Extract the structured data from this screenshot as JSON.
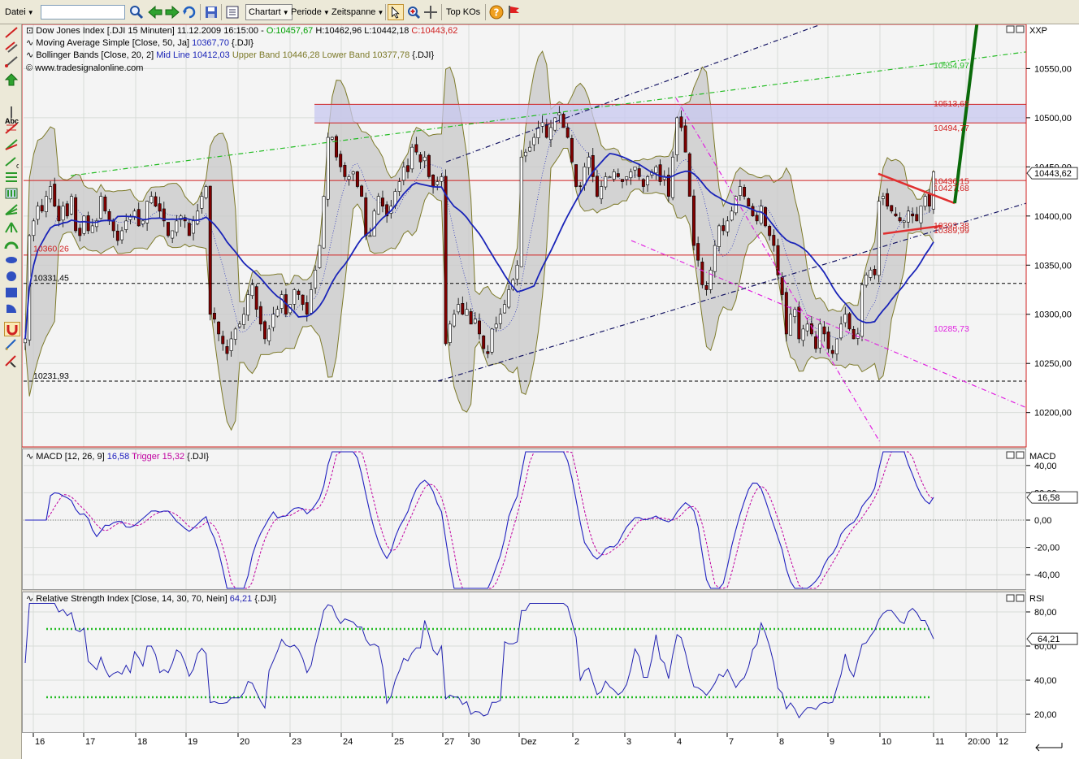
{
  "toolbar": {
    "file_menu": "Datei",
    "search_value": "",
    "chart_type": "Chartart",
    "period": "Periode",
    "timespan": "Zeitspanne",
    "top_kos": "Top KOs"
  },
  "main_panel": {
    "header_lines": [
      {
        "pre": "Dow Jones Index [.DJI  15 Minuten]  11.12.2009 16:15:00 - ",
        "o": "O:10457,67",
        "h": " H:10462,96",
        "l": " L:10442,18",
        "c": " C:10443,62"
      },
      {
        "pre": "Moving Average Simple [Close, 50, Ja] ",
        "v": "10367,70",
        "post": " {.DJI}"
      },
      {
        "pre": "Bollinger Bands [Close, 20, 2] ",
        "mid": "Mid Line 10412,03",
        "up": " Upper Band 10446,28",
        "lo": " Lower Band 10377,78",
        "post": " {.DJI}"
      },
      {
        "pre": "© www.tradesignalonline.com"
      }
    ],
    "axis_title": "XXP",
    "current_price": "10443,62",
    "y_ticks": [
      "10550,00",
      "10500,00",
      "10450,00",
      "10400,00",
      "10350,00",
      "10300,00",
      "10250,00",
      "10200,00"
    ],
    "levels_left": [
      "10360,26",
      "10331,45",
      "10231,93"
    ],
    "levels_right": {
      "l1": "10554,97",
      "l2": "10513,65",
      "l3": "10494,77",
      "l4": "10436,15",
      "l5": "10427,68",
      "l6": "10393,38",
      "l7": "10389,99",
      "l8": "10285,73"
    }
  },
  "macd_panel": {
    "header": {
      "pre": "MACD [12, 26, 9] ",
      "v": "16,58",
      "trig": " Trigger 15,32",
      "post": " {.DJI}"
    },
    "axis_title": "MACD",
    "current_value": "16,58",
    "y_ticks": [
      "40,00",
      "20,00",
      "0,00",
      "-20,00",
      "-40,00"
    ]
  },
  "rsi_panel": {
    "header": {
      "pre": "Relative Strength Index [Close, 14, 30, 70, Nein] ",
      "v": "64,21",
      "post": " {.DJI}"
    },
    "axis_title": "RSI",
    "current_value": "64,21",
    "y_ticks": [
      "80,00",
      "60,00",
      "40,00",
      "20,00"
    ]
  },
  "x_axis_labels": [
    "16",
    "17",
    "18",
    "19",
    "20",
    "23",
    "24",
    "25",
    "27",
    "30",
    "Dez",
    "2",
    "3",
    "4",
    "7",
    "8",
    "9",
    "10",
    "11",
    "20:00",
    "12"
  ],
  "colors": {
    "up": "#ffffff",
    "down": "#800000",
    "ma": "#1a24b8",
    "band": "#7d7a2a",
    "band_fill": "#c8c8c8",
    "macd": "#2020c0",
    "trigger": "#c000a0",
    "rsi": "#2020b0",
    "rsi_levels": "#22bb22",
    "hline": "#d02020",
    "zone": "#c8c8f0"
  },
  "chart_data": {
    "type": "candlestick",
    "title": "Dow Jones Index [.DJI  15 Minuten]",
    "xlabel": "",
    "ylabel": "",
    "ylim": [
      10165,
      10595
    ],
    "grid": true,
    "closes": [
      10275,
      10380,
      10395,
      10410,
      10405,
      10420,
      10430,
      10410,
      10395,
      10410,
      10400,
      10420,
      10385,
      10380,
      10400,
      10385,
      10390,
      10395,
      10420,
      10405,
      10395,
      10385,
      10375,
      10385,
      10395,
      10400,
      10405,
      10390,
      10395,
      10415,
      10420,
      10410,
      10405,
      10395,
      10380,
      10385,
      10395,
      10400,
      10395,
      10380,
      10395,
      10405,
      10420,
      10430,
      10300,
      10295,
      10280,
      10270,
      10260,
      10275,
      10285,
      10290,
      10300,
      10320,
      10330,
      10305,
      10290,
      10275,
      10285,
      10300,
      10305,
      10320,
      10300,
      10310,
      10325,
      10320,
      10310,
      10300,
      10325,
      10345,
      10370,
      10420,
      10480,
      10480,
      10460,
      10450,
      10440,
      10440,
      10445,
      10430,
      10420,
      10380,
      10380,
      10405,
      10420,
      10410,
      10400,
      10410,
      10425,
      10435,
      10450,
      10445,
      10470,
      10465,
      10455,
      10460,
      10440,
      10430,
      10435,
      10440,
      10270,
      10290,
      10300,
      10310,
      10300,
      10305,
      10290,
      10295,
      10280,
      10265,
      10260,
      10285,
      10290,
      10300,
      10310,
      10325,
      10335,
      10350,
      10460,
      10465,
      10470,
      10480,
      10490,
      10495,
      10480,
      10490,
      10500,
      10505,
      10490,
      10480,
      10455,
      10430,
      10430,
      10450,
      10460,
      10440,
      10420,
      10430,
      10440,
      10440,
      10445,
      10440,
      10435,
      10440,
      10445,
      10450,
      10440,
      10430,
      10440,
      10445,
      10450,
      10435,
      10440,
      10420,
      10460,
      10500,
      10490,
      10465,
      10420,
      10370,
      10355,
      10330,
      10325,
      10345,
      10370,
      10390,
      10385,
      10395,
      10405,
      10420,
      10430,
      10420,
      10410,
      10400,
      10395,
      10410,
      10390,
      10380,
      10370,
      10340,
      10320,
      10280,
      10300,
      10305,
      10275,
      10285,
      10290,
      10280,
      10265,
      10290,
      10280,
      10265,
      10260,
      10275,
      10290,
      10300,
      10285,
      10275,
      10280,
      10330,
      10340,
      10345,
      10340,
      10415,
      10420,
      10410,
      10405,
      10400,
      10395,
      10395,
      10405,
      10400,
      10395,
      10410,
      10420,
      10410,
      10445
    ],
    "sma50_last": 10367.7,
    "bollinger": {
      "mid": 10412.03,
      "upper": 10446.28,
      "lower": 10377.78
    },
    "horizontal_levels": [
      10513.65,
      10494.77,
      10436.15,
      10360.26
    ],
    "dashed_levels": [
      10331.45,
      10231.93
    ],
    "macd": {
      "value": 16.58,
      "trigger": 15.32,
      "ylim": [
        -50,
        50
      ]
    },
    "rsi": {
      "value": 64.21,
      "levels": [
        30,
        70
      ],
      "ylim": [
        10,
        90
      ]
    }
  }
}
